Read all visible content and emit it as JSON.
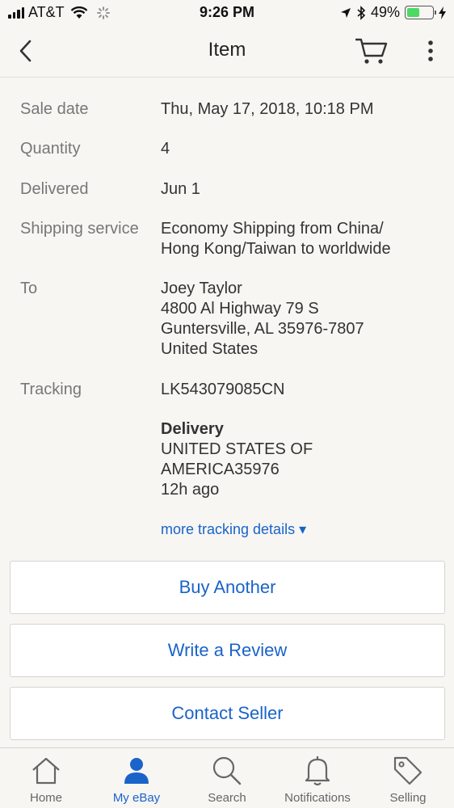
{
  "status_bar": {
    "carrier": "AT&T",
    "time": "9:26 PM",
    "battery_percent": "49%",
    "battery_level": 0.49
  },
  "nav": {
    "title": "Item",
    "icons": [
      "back-chevron-icon",
      "cart-icon",
      "more-vertical-icon"
    ]
  },
  "details": {
    "sale_date_label": "Sale date",
    "sale_date_value": "Thu, May 17, 2018, 10:18 PM",
    "quantity_label": "Quantity",
    "quantity_value": "4",
    "delivered_label": "Delivered",
    "delivered_value": "Jun 1",
    "shipping_label": "Shipping service",
    "shipping_value": "Economy Shipping from China/\nHong Kong/Taiwan to worldwide",
    "to_label": "To",
    "to_value": "Joey Taylor\n4800 Al Highway 79 S\nGuntersville, AL 35976-7807\nUnited States",
    "tracking_label": "Tracking",
    "tracking_value": "LK543079085CN"
  },
  "delivery": {
    "title": "Delivery",
    "location_line1": "UNITED STATES OF",
    "location_line2": "AMERICA35976",
    "time_ago": "12h ago"
  },
  "more_tracking_link": "more tracking details ▾",
  "actions": {
    "buy_another": "Buy Another",
    "write_review": "Write a Review",
    "contact_seller": "Contact Seller"
  },
  "tab_bar": {
    "home": "Home",
    "my_ebay": "My eBay",
    "search": "Search",
    "notifications": "Notifications",
    "selling": "Selling",
    "active": "my_ebay"
  },
  "colors": {
    "accent": "#1a63c9",
    "background": "#f7f6f3",
    "battery": "#4cd964"
  }
}
